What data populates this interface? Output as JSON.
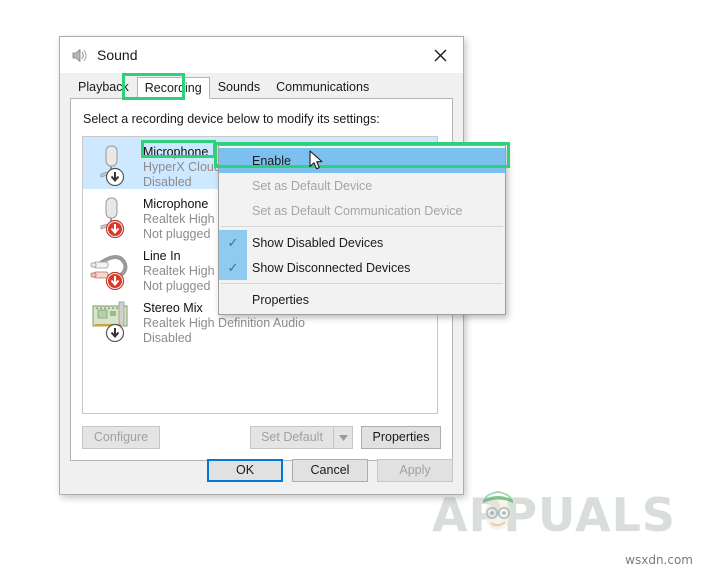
{
  "window": {
    "title": "Sound",
    "title_icon": "speaker-icon",
    "close_label": "✕"
  },
  "tabs": [
    {
      "label": "Playback",
      "selected": false
    },
    {
      "label": "Recording",
      "selected": true
    },
    {
      "label": "Sounds",
      "selected": false
    },
    {
      "label": "Communications",
      "selected": false
    }
  ],
  "panel": {
    "instruction": "Select a recording device below to modify its settings:"
  },
  "devices": [
    {
      "name": "Microphone",
      "driver": "HyperX Cloud",
      "status": "Disabled",
      "icon": "microphone-icon",
      "badge": "down-arrow-gray",
      "selected": true
    },
    {
      "name": "Microphone",
      "driver": "Realtek High",
      "status": "Not plugged",
      "icon": "microphone-icon",
      "badge": "down-arrow-red",
      "selected": false
    },
    {
      "name": "Line In",
      "driver": "Realtek High",
      "status": "Not plugged",
      "icon": "line-in-icon",
      "badge": "down-arrow-red",
      "selected": false
    },
    {
      "name": "Stereo Mix",
      "driver": "Realtek High Definition Audio",
      "status": "Disabled",
      "icon": "sound-card-icon",
      "badge": "down-arrow-gray",
      "selected": false
    }
  ],
  "context_menu": {
    "items": [
      {
        "label": "Enable",
        "disabled": false,
        "highlighted": true,
        "checked": false
      },
      {
        "label": "Set as Default Device",
        "disabled": true,
        "highlighted": false,
        "checked": false
      },
      {
        "label": "Set as Default Communication Device",
        "disabled": true,
        "highlighted": false,
        "checked": false
      },
      {
        "separator": true
      },
      {
        "label": "Show Disabled Devices",
        "disabled": false,
        "highlighted": false,
        "checked": true
      },
      {
        "label": "Show Disconnected Devices",
        "disabled": false,
        "highlighted": false,
        "checked": true
      },
      {
        "separator": true
      },
      {
        "label": "Properties",
        "disabled": false,
        "highlighted": false,
        "checked": false
      }
    ],
    "check_glyph": "✓"
  },
  "panel_buttons": {
    "configure": "Configure",
    "set_default": "Set Default",
    "set_default_arrow": "▼",
    "properties": "Properties"
  },
  "dialog_buttons": {
    "ok": "OK",
    "cancel": "Cancel",
    "apply": "Apply"
  },
  "annotations": {
    "highlight_color": "#2fd07a",
    "selection_color": "#cde8ff",
    "menu_highlight_color": "#7cc0ef",
    "accent_color": "#0078d7"
  },
  "watermarks": {
    "brand": "APPUALS",
    "source": "wsxdn.com"
  }
}
